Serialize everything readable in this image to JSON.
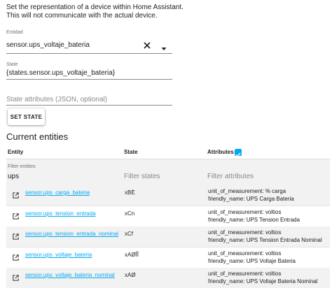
{
  "description": {
    "line1": "Set the representation of a device within Home Assistant.",
    "line2": "This will not communicate with the actual device."
  },
  "entity_field": {
    "label": "Entidad",
    "value": "sensor.ups_voltaje_bateria",
    "clear_icon": "close-icon",
    "dropdown_icon": "arrow-drop-down-icon"
  },
  "state_field": {
    "label": "State",
    "value": "{states.sensor.ups_voltaje_bateria}"
  },
  "attributes_field": {
    "placeholder": "State attributes (JSON, optional)"
  },
  "set_state_button": {
    "label": "SET STATE"
  },
  "current_entities": {
    "title": "Current entities",
    "columns": {
      "entity": "Entity",
      "state": "State",
      "attributes": "Attributes"
    },
    "attributes_checked": true,
    "filters": {
      "entities_label": "Filter entities",
      "entities_value": "ups",
      "states_placeholder": "Filter states",
      "attributes_placeholder": "Filter attributes"
    },
    "rows": [
      {
        "entity": "sensor.ups_carga_bateria",
        "state": "xBÈ",
        "attr1": "unit_of_measurement: % carga",
        "attr2": "friendly_name: UPS Carga Bateria"
      },
      {
        "entity": "sensor.ups_tension_entrada",
        "state": "xCn",
        "attr1": "unit_of_measurement: voltios",
        "attr2": "friendly_name: UPS Tension Entrada"
      },
      {
        "entity": "sensor.ups_tension_entrada_nominal",
        "state": "xCf",
        "attr1": "unit_of_measurement: voltios",
        "attr2": "friendly_name: UPS Tension Entrada Nominal"
      },
      {
        "entity": "sensor.ups_voltaje_bateria",
        "state": "xAØÎÎ",
        "attr1": "unit_of_measurement: voltios",
        "attr2": "friendly_name: UPS Voltaje Bateria"
      },
      {
        "entity": "sensor.ups_voltaje_bateria_nominal",
        "state": "xAØ",
        "attr1": "unit_of_measurement: voltios",
        "attr2": "friendly_name: UPS Voltaje Bateria Nominal"
      }
    ],
    "row_icon": "open-in-new-icon"
  },
  "colors": {
    "accent": "#03a9f4",
    "row_shade": "#f2f2f2"
  }
}
